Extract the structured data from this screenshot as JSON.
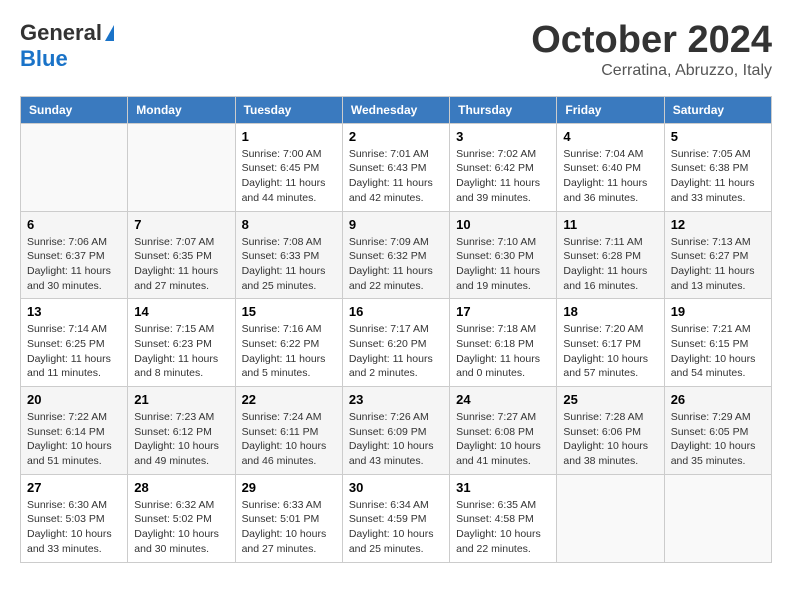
{
  "header": {
    "logo_general": "General",
    "logo_blue": "Blue",
    "month_title": "October 2024",
    "location": "Cerratina, Abruzzo, Italy"
  },
  "weekdays": [
    "Sunday",
    "Monday",
    "Tuesday",
    "Wednesday",
    "Thursday",
    "Friday",
    "Saturday"
  ],
  "weeks": [
    [
      {
        "day": "",
        "detail": ""
      },
      {
        "day": "",
        "detail": ""
      },
      {
        "day": "1",
        "detail": "Sunrise: 7:00 AM\nSunset: 6:45 PM\nDaylight: 11 hours and 44 minutes."
      },
      {
        "day": "2",
        "detail": "Sunrise: 7:01 AM\nSunset: 6:43 PM\nDaylight: 11 hours and 42 minutes."
      },
      {
        "day": "3",
        "detail": "Sunrise: 7:02 AM\nSunset: 6:42 PM\nDaylight: 11 hours and 39 minutes."
      },
      {
        "day": "4",
        "detail": "Sunrise: 7:04 AM\nSunset: 6:40 PM\nDaylight: 11 hours and 36 minutes."
      },
      {
        "day": "5",
        "detail": "Sunrise: 7:05 AM\nSunset: 6:38 PM\nDaylight: 11 hours and 33 minutes."
      }
    ],
    [
      {
        "day": "6",
        "detail": "Sunrise: 7:06 AM\nSunset: 6:37 PM\nDaylight: 11 hours and 30 minutes."
      },
      {
        "day": "7",
        "detail": "Sunrise: 7:07 AM\nSunset: 6:35 PM\nDaylight: 11 hours and 27 minutes."
      },
      {
        "day": "8",
        "detail": "Sunrise: 7:08 AM\nSunset: 6:33 PM\nDaylight: 11 hours and 25 minutes."
      },
      {
        "day": "9",
        "detail": "Sunrise: 7:09 AM\nSunset: 6:32 PM\nDaylight: 11 hours and 22 minutes."
      },
      {
        "day": "10",
        "detail": "Sunrise: 7:10 AM\nSunset: 6:30 PM\nDaylight: 11 hours and 19 minutes."
      },
      {
        "day": "11",
        "detail": "Sunrise: 7:11 AM\nSunset: 6:28 PM\nDaylight: 11 hours and 16 minutes."
      },
      {
        "day": "12",
        "detail": "Sunrise: 7:13 AM\nSunset: 6:27 PM\nDaylight: 11 hours and 13 minutes."
      }
    ],
    [
      {
        "day": "13",
        "detail": "Sunrise: 7:14 AM\nSunset: 6:25 PM\nDaylight: 11 hours and 11 minutes."
      },
      {
        "day": "14",
        "detail": "Sunrise: 7:15 AM\nSunset: 6:23 PM\nDaylight: 11 hours and 8 minutes."
      },
      {
        "day": "15",
        "detail": "Sunrise: 7:16 AM\nSunset: 6:22 PM\nDaylight: 11 hours and 5 minutes."
      },
      {
        "day": "16",
        "detail": "Sunrise: 7:17 AM\nSunset: 6:20 PM\nDaylight: 11 hours and 2 minutes."
      },
      {
        "day": "17",
        "detail": "Sunrise: 7:18 AM\nSunset: 6:18 PM\nDaylight: 11 hours and 0 minutes."
      },
      {
        "day": "18",
        "detail": "Sunrise: 7:20 AM\nSunset: 6:17 PM\nDaylight: 10 hours and 57 minutes."
      },
      {
        "day": "19",
        "detail": "Sunrise: 7:21 AM\nSunset: 6:15 PM\nDaylight: 10 hours and 54 minutes."
      }
    ],
    [
      {
        "day": "20",
        "detail": "Sunrise: 7:22 AM\nSunset: 6:14 PM\nDaylight: 10 hours and 51 minutes."
      },
      {
        "day": "21",
        "detail": "Sunrise: 7:23 AM\nSunset: 6:12 PM\nDaylight: 10 hours and 49 minutes."
      },
      {
        "day": "22",
        "detail": "Sunrise: 7:24 AM\nSunset: 6:11 PM\nDaylight: 10 hours and 46 minutes."
      },
      {
        "day": "23",
        "detail": "Sunrise: 7:26 AM\nSunset: 6:09 PM\nDaylight: 10 hours and 43 minutes."
      },
      {
        "day": "24",
        "detail": "Sunrise: 7:27 AM\nSunset: 6:08 PM\nDaylight: 10 hours and 41 minutes."
      },
      {
        "day": "25",
        "detail": "Sunrise: 7:28 AM\nSunset: 6:06 PM\nDaylight: 10 hours and 38 minutes."
      },
      {
        "day": "26",
        "detail": "Sunrise: 7:29 AM\nSunset: 6:05 PM\nDaylight: 10 hours and 35 minutes."
      }
    ],
    [
      {
        "day": "27",
        "detail": "Sunrise: 6:30 AM\nSunset: 5:03 PM\nDaylight: 10 hours and 33 minutes."
      },
      {
        "day": "28",
        "detail": "Sunrise: 6:32 AM\nSunset: 5:02 PM\nDaylight: 10 hours and 30 minutes."
      },
      {
        "day": "29",
        "detail": "Sunrise: 6:33 AM\nSunset: 5:01 PM\nDaylight: 10 hours and 27 minutes."
      },
      {
        "day": "30",
        "detail": "Sunrise: 6:34 AM\nSunset: 4:59 PM\nDaylight: 10 hours and 25 minutes."
      },
      {
        "day": "31",
        "detail": "Sunrise: 6:35 AM\nSunset: 4:58 PM\nDaylight: 10 hours and 22 minutes."
      },
      {
        "day": "",
        "detail": ""
      },
      {
        "day": "",
        "detail": ""
      }
    ]
  ]
}
